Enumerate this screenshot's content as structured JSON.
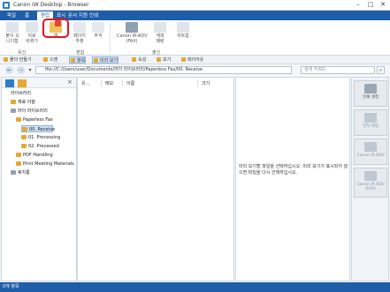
{
  "window": {
    "title": "Canon iW Desktop - Browser",
    "min": "–",
    "max": "□",
    "close": "✕"
  },
  "tabs": [
    "파일",
    "홈",
    "편집",
    "표시",
    "문서 지원",
    "인쇄"
  ],
  "ribbon": {
    "buttons": [
      {
        "label": "붙이 오\n니다함"
      },
      {
        "label": "지로\n바뀌기"
      },
      {
        "label": "열"
      },
      {
        "label": "페이지\n추출"
      },
      {
        "label": "주석"
      },
      {
        "label": "Canon iR-ADV\n(FAX)"
      },
      {
        "label": "캐피\n패랑"
      },
      {
        "label": "자트힘"
      }
    ],
    "groups": [
      "유신",
      "편집",
      "출신"
    ]
  },
  "toolbar2": [
    "폴더 만들기",
    "스캔",
    "항목",
    "미리 보기",
    "속성",
    "보기",
    "레이아웃"
  ],
  "address": {
    "path": "file://C:/Users/user/Documents/마이 라이브러리/Paperless Fax/00. Receive",
    "search_placeholder": "검색 키워드"
  },
  "leftpane": {
    "tree": [
      {
        "label": "라이브러리",
        "level": 0
      },
      {
        "label": "제료 야을",
        "level": 1
      },
      {
        "label": "마이 라이브러리",
        "level": 1
      },
      {
        "label": "Paperless Fax",
        "level": 2
      },
      {
        "label": "00. Receive",
        "level": 3,
        "selected": true
      },
      {
        "label": "01. Processing",
        "level": 3
      },
      {
        "label": "02. Processed",
        "level": 3
      },
      {
        "label": "PDF Handling",
        "level": 2
      },
      {
        "label": "Print Meeting Materials",
        "level": 2
      },
      {
        "label": "휴지통",
        "level": 1
      }
    ]
  },
  "listpane": {
    "columns": [
      "유...",
      "메모",
      "이름",
      "크기"
    ]
  },
  "preview": {
    "message": "미리 보기할 파일을 선택하십시오. 미리 보기가 표시되지 않으면 파일을 다시 선택하십시오."
  },
  "rightpane": {
    "buttons": [
      {
        "label": "인쇄 설정",
        "dim": false
      },
      {
        "label": "전자 메일",
        "dim": true
      },
      {
        "label": "Canon iR-ADV",
        "dim": true
      },
      {
        "label": "Canon iR-ADV\n(FAX)",
        "dim": true
      }
    ]
  },
  "status": {
    "text": "0개 항목"
  }
}
